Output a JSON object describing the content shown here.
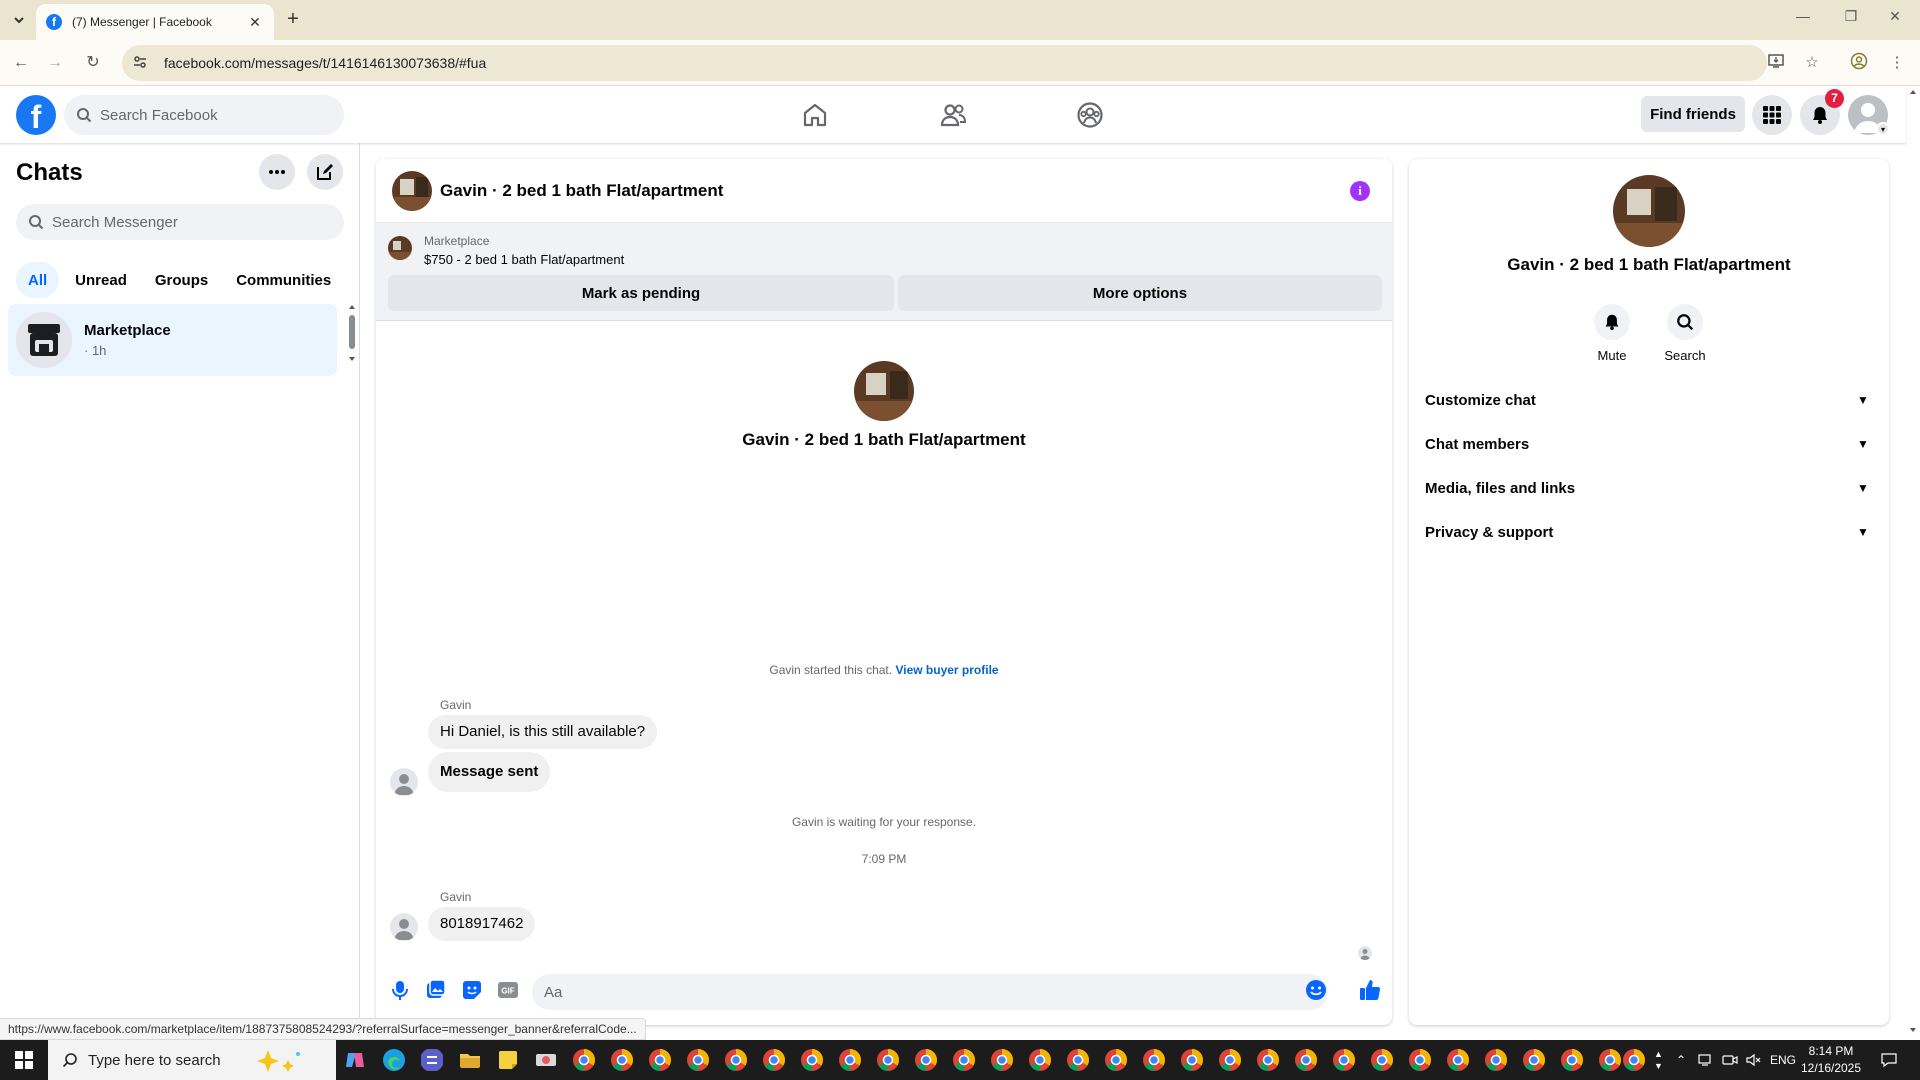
{
  "browser": {
    "tab_title": "(7) Messenger | Facebook",
    "url": "facebook.com/messages/t/1416146130073638/#fua",
    "status_url": "https://www.facebook.com/marketplace/item/1887375808524293/?referralSurface=messenger_banner&referralCode..."
  },
  "header": {
    "search_placeholder": "Search Facebook",
    "find_friends": "Find friends",
    "notification_count": "7"
  },
  "sidebar": {
    "title": "Chats",
    "search_placeholder": "Search Messenger",
    "filters": [
      "All",
      "Unread",
      "Groups",
      "Communities"
    ],
    "active_filter": "All",
    "chats": [
      {
        "name": "Marketplace",
        "time": "· 1h"
      }
    ]
  },
  "conversation": {
    "title": "Gavin · 2 bed 1 bath Flat/apartment",
    "marketplace_label": "Marketplace",
    "listing": "$750 - 2 bed 1 bath Flat/apartment",
    "mark_pending": "Mark as pending",
    "more_options": "More options",
    "started_text": "Gavin started this chat.",
    "view_buyer_profile": "View buyer profile",
    "sender_name": "Gavin",
    "message1": "Hi Daniel, is this still available?",
    "message2": "Message sent",
    "waiting_text": "Gavin is waiting for your response.",
    "timestamp": "7:09 PM",
    "sender_name2": "Gavin",
    "message3": "8018917462",
    "composer_placeholder": "Aa"
  },
  "details": {
    "name": "Gavin · 2 bed 1 bath Flat/apartment",
    "actions": [
      "Mute",
      "Search"
    ],
    "sections": [
      "Customize chat",
      "Chat members",
      "Media, files and links",
      "Privacy & support"
    ]
  },
  "taskbar": {
    "search_placeholder": "Type here to search",
    "language": "ENG",
    "time": "8:14 PM",
    "date": "12/16/2025"
  },
  "colors": {
    "facebook_blue": "#1877f2",
    "messenger_accent": "#a033ff",
    "active_filter_bg": "#ebf5ff",
    "badge_red": "#e41e3f"
  }
}
